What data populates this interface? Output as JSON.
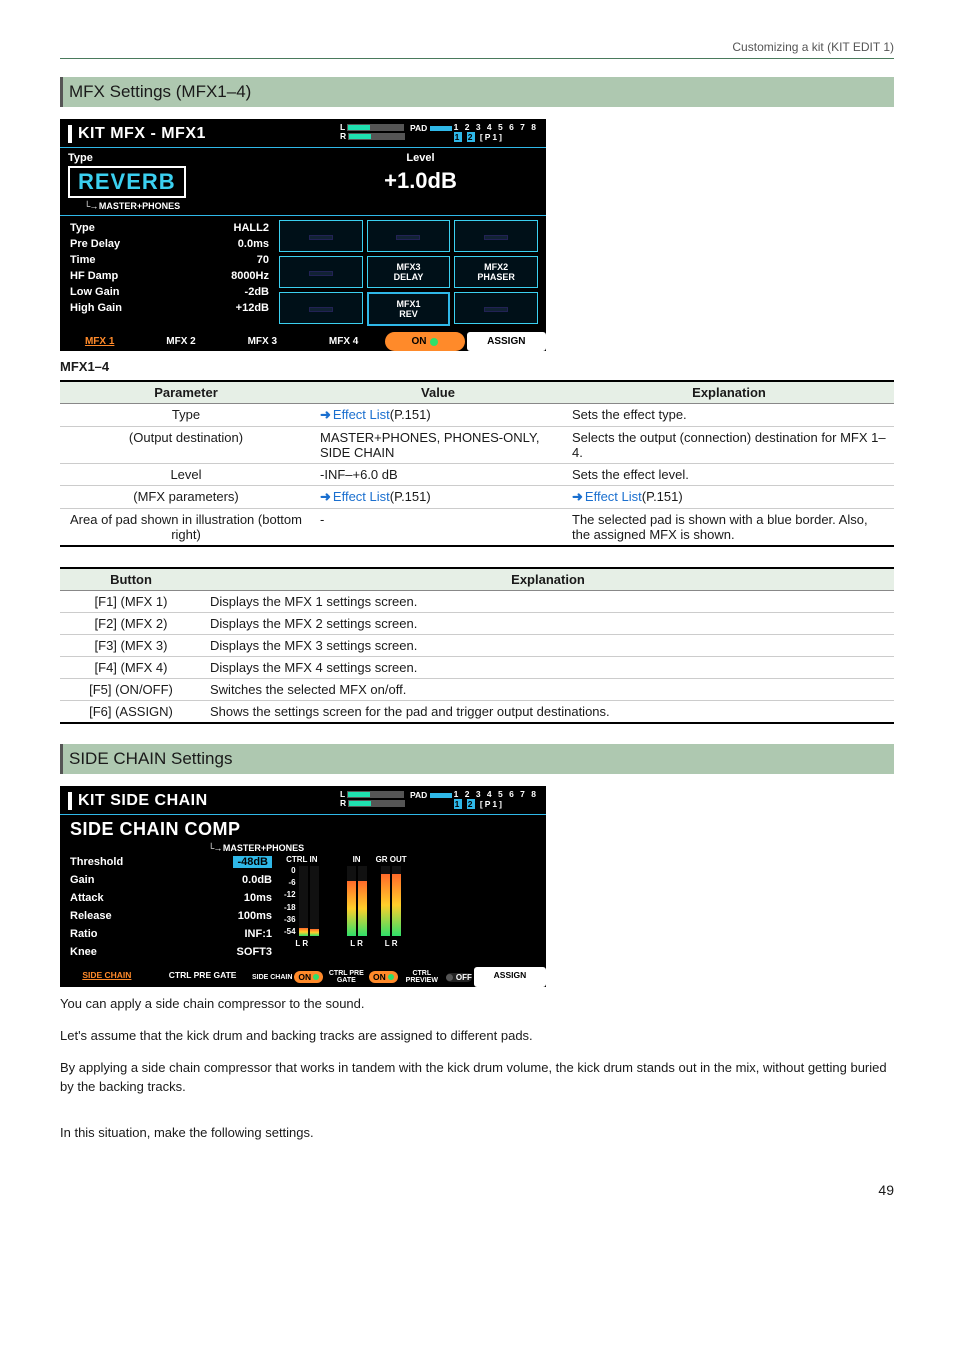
{
  "header": {
    "trail": "Customizing a kit (KIT EDIT 1)"
  },
  "sec1": {
    "heading": "MFX Settings (MFX1–4)",
    "sub": "MFX1–4"
  },
  "lcd1": {
    "title": "KIT MFX - MFX1",
    "l": "L",
    "r": "R",
    "pad": "PAD",
    "grid1": "1 2 3 4 5 6 7 8",
    "grid2a": "1",
    "grid2b": "2",
    "grid2c": "[P1]",
    "type_lbl": "Type",
    "type_val": "REVERB",
    "dest": "MASTER+PHONES",
    "level_lbl": "Level",
    "level_val": "+1.0dB",
    "params": [
      {
        "k": "Type",
        "v": "HALL2"
      },
      {
        "k": "Pre Delay",
        "v": "0.0ms"
      },
      {
        "k": "Time",
        "v": "70"
      },
      {
        "k": "HF Damp",
        "v": "8000Hz"
      },
      {
        "k": "Low Gain",
        "v": "-2dB"
      },
      {
        "k": "High Gain",
        "v": "+12dB"
      }
    ],
    "slots": {
      "mfx3": "MFX3",
      "mfx3b": "DELAY",
      "mfx2": "MFX2",
      "mfx2b": "PHASER",
      "mfx1": "MFX1",
      "mfx1b": "REV"
    },
    "tabs": {
      "t1": "MFX 1",
      "t2": "MFX 2",
      "t3": "MFX 3",
      "t4": "MFX 4",
      "on": "ON",
      "assign": "ASSIGN"
    }
  },
  "table1": {
    "h1": "Parameter",
    "h2": "Value",
    "h3": "Explanation",
    "rows": [
      {
        "p": "Type",
        "v_pre": "Effect List",
        "v_post": "(P.151)",
        "e": "Sets the effect type.",
        "link": true,
        "arrow": true
      },
      {
        "p": "(Output destination)",
        "v": "MASTER+PHONES, PHONES-ONLY, SIDE CHAIN",
        "e": "Selects the output (connection) destination for MFX 1–4."
      },
      {
        "p": "Level",
        "v": "-INF–+6.0 dB",
        "e": "Sets the effect level."
      },
      {
        "p": "(MFX parameters)",
        "v_pre": "Effect List",
        "v_post": "(P.151)",
        "e_pre": "Effect List",
        "e_post": "(P.151)",
        "link": true,
        "arrow": true,
        "elink": true
      },
      {
        "p": "Area of pad shown in illustration (bottom right)",
        "v": "-",
        "e": "The selected pad is shown with a blue border. Also, the assigned MFX is shown."
      }
    ]
  },
  "table2": {
    "h1": "Button",
    "h2": "Explanation",
    "rows": [
      {
        "b": "[F1] (MFX 1)",
        "e": "Displays the MFX 1 settings screen."
      },
      {
        "b": "[F2] (MFX 2)",
        "e": "Displays the MFX 2 settings screen."
      },
      {
        "b": "[F3] (MFX 3)",
        "e": "Displays the MFX 3 settings screen."
      },
      {
        "b": "[F4] (MFX 4)",
        "e": "Displays the MFX 4 settings screen."
      },
      {
        "b": "[F5] (ON/OFF)",
        "e": "Switches the selected MFX on/off."
      },
      {
        "b": "[F6] (ASSIGN)",
        "e": "Shows the settings screen for the pad and trigger output destinations."
      }
    ]
  },
  "sec2": {
    "heading": "SIDE CHAIN Settings"
  },
  "lcd2": {
    "title": "KIT SIDE CHAIN",
    "big": "SIDE CHAIN COMP",
    "dest": "MASTER+PHONES",
    "ctrl_in": "CTRL IN",
    "in": "IN",
    "grout": "GR OUT",
    "scale": [
      "0",
      "-6",
      "-12",
      "-18",
      "-36",
      "-54"
    ],
    "lr": "L  R",
    "params": [
      {
        "k": "Threshold",
        "v": "-48dB",
        "hl": true
      },
      {
        "k": "Gain",
        "v": "0.0dB"
      },
      {
        "k": "Attack",
        "v": "10ms"
      },
      {
        "k": "Release",
        "v": "100ms"
      },
      {
        "k": "Ratio",
        "v": "INF:1"
      },
      {
        "k": "Knee",
        "v": "SOFT3"
      }
    ],
    "tabs": {
      "t1": "SIDE CHAIN",
      "t2": "CTRL PRE GATE",
      "g3": "SIDE CHAIN",
      "g4": "CTRL PRE GATE",
      "g5": "CTRL PREVIEW",
      "on": "ON",
      "off": "OFF",
      "assign": "ASSIGN"
    }
  },
  "body_paras": [
    "You can apply a side chain compressor to the sound.",
    "Let's assume that the kick drum and backing tracks are assigned to different pads.",
    "By applying a side chain compressor that works in tandem with the kick drum volume, the kick drum stands out in the mix, without getting buried by the backing tracks.",
    "In this situation, make the following settings."
  ],
  "page": "49"
}
